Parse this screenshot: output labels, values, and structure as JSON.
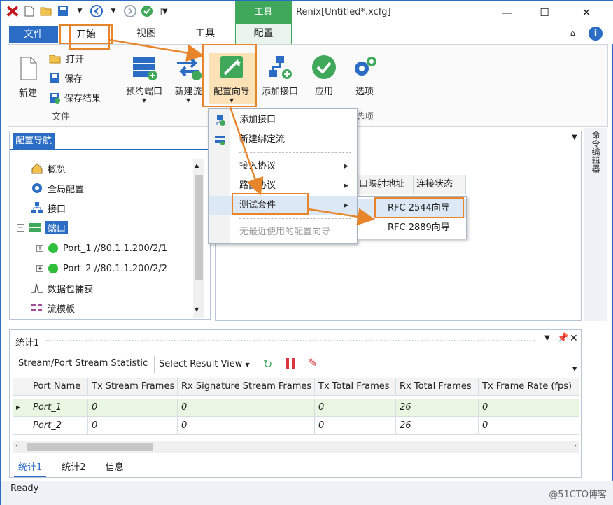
{
  "window": {
    "title": "Renix[Untitled*.xcfg]",
    "context_tab_group": "工具"
  },
  "tabs": {
    "file": "文件",
    "start": "开始",
    "view": "视图",
    "tools": "工具",
    "config": "配置"
  },
  "ribbon": {
    "new": "新建",
    "open": "打开",
    "save": "保存",
    "save_results": "保存结果",
    "file_group": "文件",
    "reserve_port": "预约端口",
    "new_stream": "新建流",
    "config_wizard": "配置向导",
    "add_interface": "添加接口",
    "apply": "应用",
    "options": "选项",
    "options_group": "选项"
  },
  "nav": {
    "title": "配置导航",
    "items": [
      {
        "label": "概览",
        "icon": "home-icon"
      },
      {
        "label": "全局配置",
        "icon": "gear-icon"
      },
      {
        "label": "接口",
        "icon": "network-icon"
      },
      {
        "label": "端口",
        "icon": "port-icon"
      },
      {
        "label": "Port_1 //80.1.1.200/2/1",
        "icon": "status-green-icon"
      },
      {
        "label": "Port_2 //80.1.1.200/2/2",
        "icon": "status-green-icon"
      },
      {
        "label": "数据包捕获",
        "icon": "wave-icon"
      },
      {
        "label": "流模板",
        "icon": "template-icon"
      }
    ]
  },
  "right_panel": {
    "col1": "口映射地址",
    "col2": "连接状态"
  },
  "side_strip": "命令编辑器",
  "menu": {
    "items": [
      "添加接口",
      "新建绑定流",
      "接入协议",
      "路由协议",
      "测试套件",
      "无最近使用的配置向导"
    ]
  },
  "submenu": {
    "items": [
      "RFC 2544向导",
      "RFC 2889向导"
    ]
  },
  "stats": {
    "title": "统计1",
    "view_name": "Stream/Port Stream Statistic",
    "select_view": "Select Result View",
    "columns": [
      "Port Name",
      "Tx Stream Frames",
      "Rx Signature Stream Frames",
      "Tx Total Frames",
      "Rx Total Frames",
      "Tx Frame Rate (fps)"
    ],
    "rows": [
      [
        "Port_1",
        "0",
        "0",
        "0",
        "26",
        "0"
      ],
      [
        "Port_2",
        "0",
        "0",
        "0",
        "26",
        "0"
      ]
    ],
    "tabs": [
      "统计1",
      "统计2",
      "信息"
    ]
  },
  "status": {
    "text": "Ready",
    "watermark": "@51CTO博客"
  },
  "colors": {
    "accent": "#2b6cc4",
    "highlight": "#e8852b",
    "context": "#3fa85a"
  }
}
